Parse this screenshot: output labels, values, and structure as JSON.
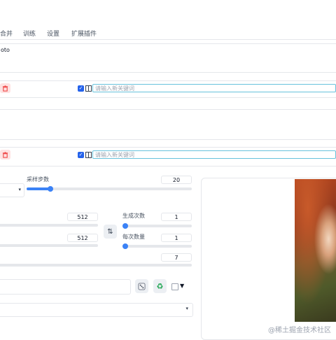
{
  "tabs": [
    "合并",
    "训练",
    "设置",
    "扩展插件"
  ],
  "prompt_fragment": "oto",
  "keyword_placeholder_1": "请输入新关键词",
  "keyword_placeholder_2": "请输入新关键词",
  "sampling_steps": {
    "label": "采样步数",
    "value": "20",
    "fraction": 0.12
  },
  "width": {
    "value": "512"
  },
  "height": {
    "value": "512"
  },
  "batch_count": {
    "label": "生成次数",
    "value": "1",
    "fraction": 0.0
  },
  "batch_size": {
    "label": "每次数量",
    "value": "1",
    "fraction": 0.0
  },
  "cfg": {
    "value": "7"
  },
  "extra_toggle_glyph": "▼",
  "watermark": "@稀土掘金技术社区",
  "icons": [
    "trash-icon",
    "swap-icon",
    "dice-icon",
    "recycle-icon",
    "chevron-down-icon"
  ],
  "colors": {
    "accent": "#3b82f6",
    "keyword_border": "#67c2dc",
    "trash_bg": "#fee2e2"
  }
}
